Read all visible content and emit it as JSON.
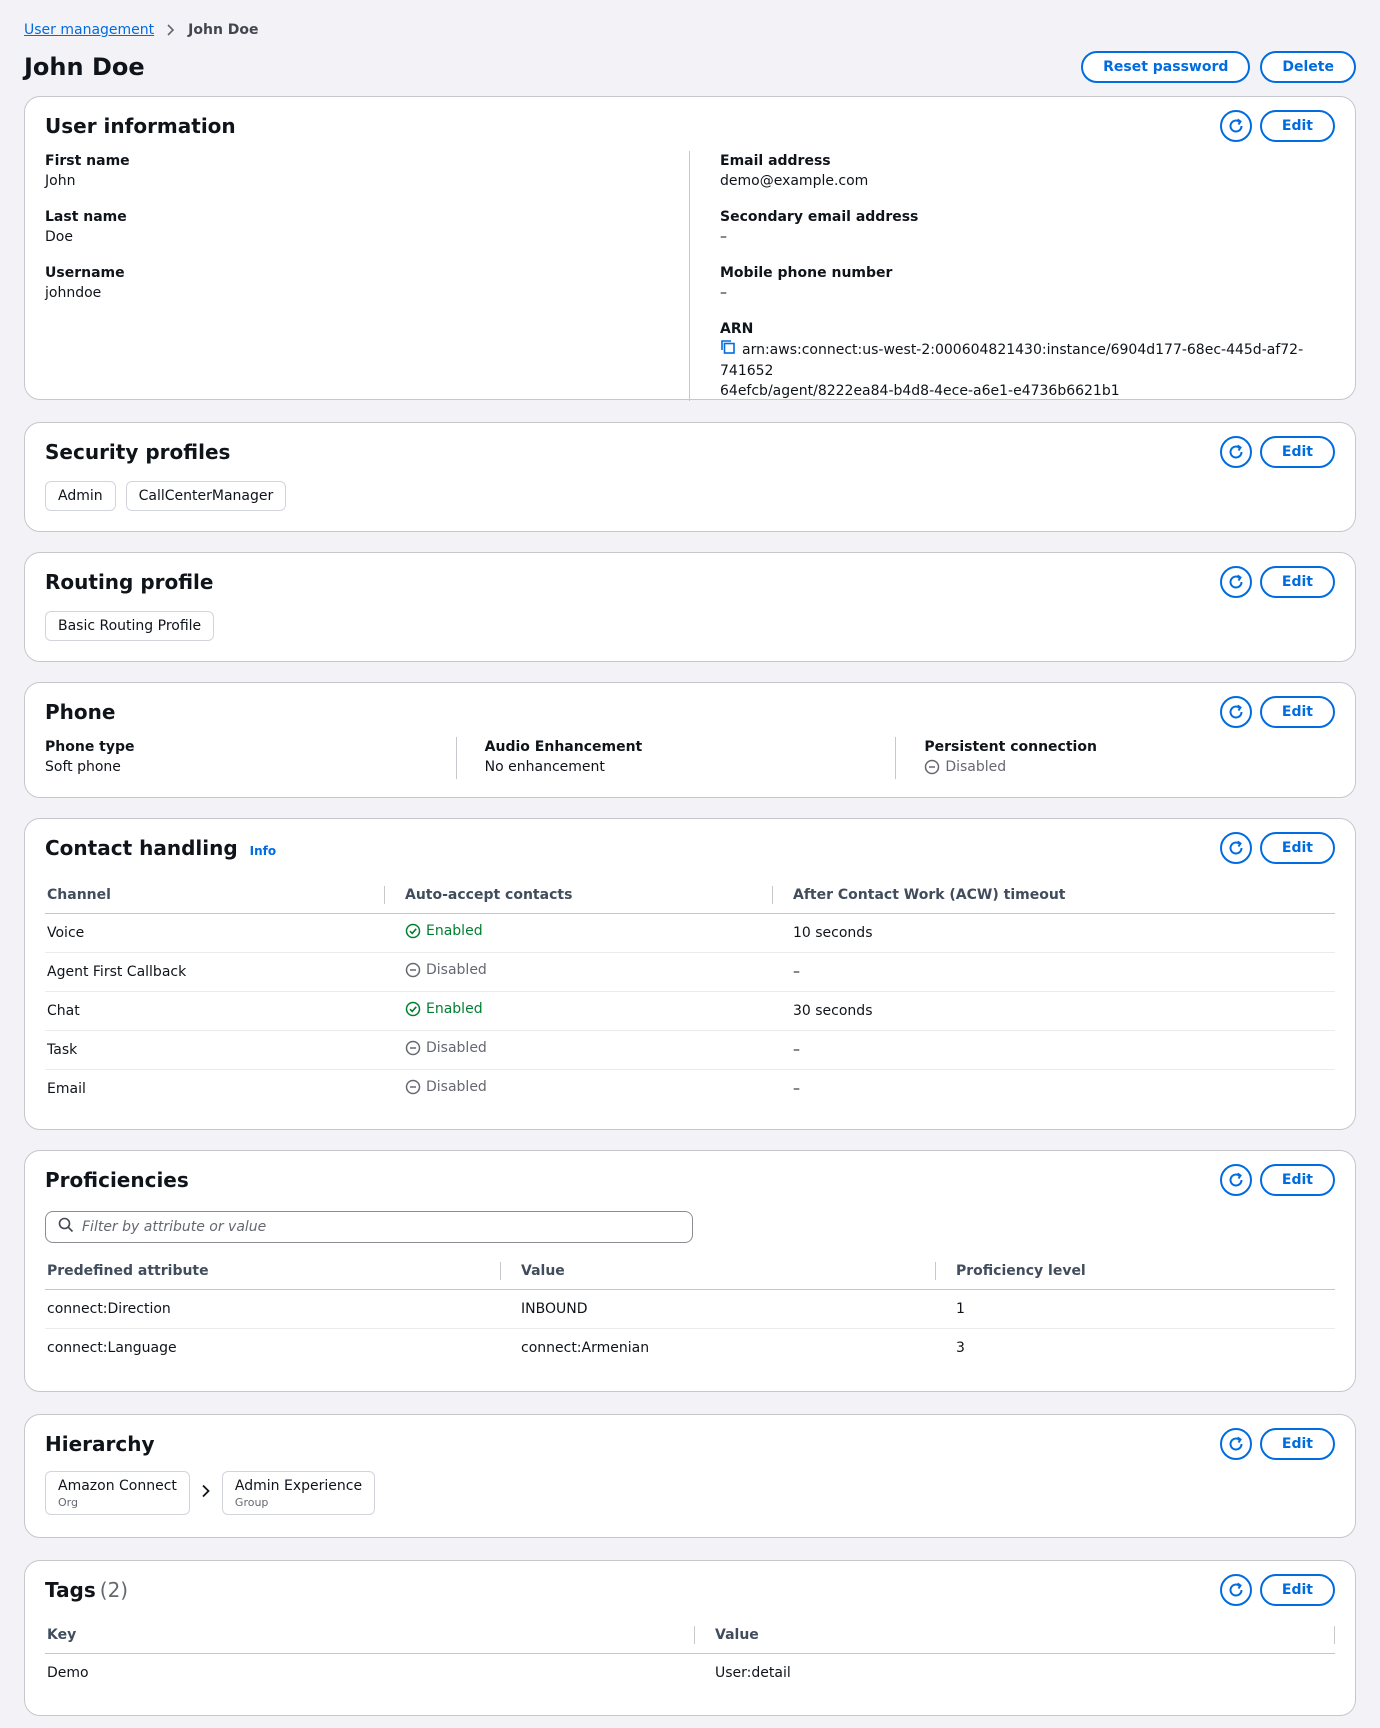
{
  "breadcrumb": {
    "parent": "User management",
    "current": "John Doe"
  },
  "page": {
    "title": "John Doe",
    "reset_password_label": "Reset password",
    "delete_label": "Delete"
  },
  "common": {
    "edit_label": "Edit"
  },
  "user_information": {
    "title": "User information",
    "first_name_label": "First name",
    "first_name": "John",
    "last_name_label": "Last name",
    "last_name": "Doe",
    "username_label": "Username",
    "username": "johndoe",
    "email_label": "Email address",
    "email": "demo@example.com",
    "secondary_email_label": "Secondary email address",
    "secondary_email": "–",
    "mobile_label": "Mobile phone number",
    "mobile": "–",
    "arn_label": "ARN",
    "arn_line1": "arn:aws:connect:us-west-2:000604821430:instance/6904d177-68ec-445d-af72-741652",
    "arn_line2": "64efcb/agent/8222ea84-b4d8-4ece-a6e1-e4736b6621b1"
  },
  "security_profiles": {
    "title": "Security profiles",
    "items": [
      "Admin",
      "CallCenterManager"
    ]
  },
  "routing_profile": {
    "title": "Routing profile",
    "value": "Basic Routing Profile"
  },
  "phone": {
    "title": "Phone",
    "phone_type_label": "Phone type",
    "phone_type": "Soft phone",
    "audio_label": "Audio Enhancement",
    "audio": "No enhancement",
    "persistent_label": "Persistent connection",
    "persistent": "Disabled"
  },
  "contact_handling": {
    "title": "Contact handling",
    "info_label": "Info",
    "columns": [
      "Channel",
      "Auto-accept contacts",
      "After Contact Work (ACW) timeout"
    ],
    "rows": [
      {
        "channel": "Voice",
        "auto_accept": "Enabled",
        "status": "enabled",
        "acw": "10 seconds"
      },
      {
        "channel": "Agent First Callback",
        "auto_accept": "Disabled",
        "status": "disabled",
        "acw": "–"
      },
      {
        "channel": "Chat",
        "auto_accept": "Enabled",
        "status": "enabled",
        "acw": "30 seconds"
      },
      {
        "channel": "Task",
        "auto_accept": "Disabled",
        "status": "disabled",
        "acw": "–"
      },
      {
        "channel": "Email",
        "auto_accept": "Disabled",
        "status": "disabled",
        "acw": "–"
      }
    ]
  },
  "proficiencies": {
    "title": "Proficiencies",
    "search_placeholder": "Filter by attribute or value",
    "columns": [
      "Predefined attribute",
      "Value",
      "Proficiency level"
    ],
    "rows": [
      {
        "attribute": "connect:Direction",
        "value": "INBOUND",
        "level": "1"
      },
      {
        "attribute": "connect:Language",
        "value": "connect:Armenian",
        "level": "3"
      }
    ]
  },
  "hierarchy": {
    "title": "Hierarchy",
    "nodes": [
      {
        "name": "Amazon Connect",
        "level": "Org"
      },
      {
        "name": "Admin Experience",
        "level": "Group"
      }
    ]
  },
  "tags": {
    "title": "Tags",
    "count": "(2)",
    "columns": [
      "Key",
      "Value"
    ],
    "rows": [
      {
        "key": "Demo",
        "value": "User:detail"
      }
    ]
  }
}
